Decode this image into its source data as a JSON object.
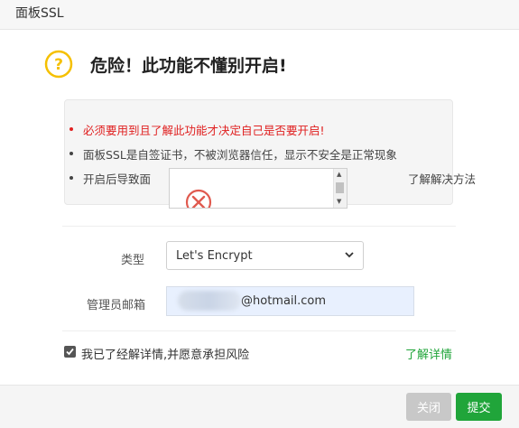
{
  "dialog": {
    "title": "面板SSL"
  },
  "warning": {
    "title": "危险！此功能不懂别开启!"
  },
  "notice": {
    "items": [
      "必须要用到且了解此功能才决定自己是否要开启!",
      "面板SSL是自签证书，不被浏览器信任，显示不安全是正常现象",
      "开启后导致面"
    ],
    "item3_tail": "了解解决方法"
  },
  "form": {
    "type_label": "类型",
    "type_value": "Let's Encrypt",
    "email_label": "管理员邮箱",
    "email_value": "@hotmail.com"
  },
  "agreement": {
    "label": "我已了经解详情,并愿意承担风险",
    "checked": true,
    "link": "了解详情"
  },
  "footer": {
    "close_label": "关闭",
    "submit_label": "提交"
  },
  "colors": {
    "accent": "#20a53a",
    "danger": "#e02020",
    "warn_icon": "#f5c000"
  }
}
